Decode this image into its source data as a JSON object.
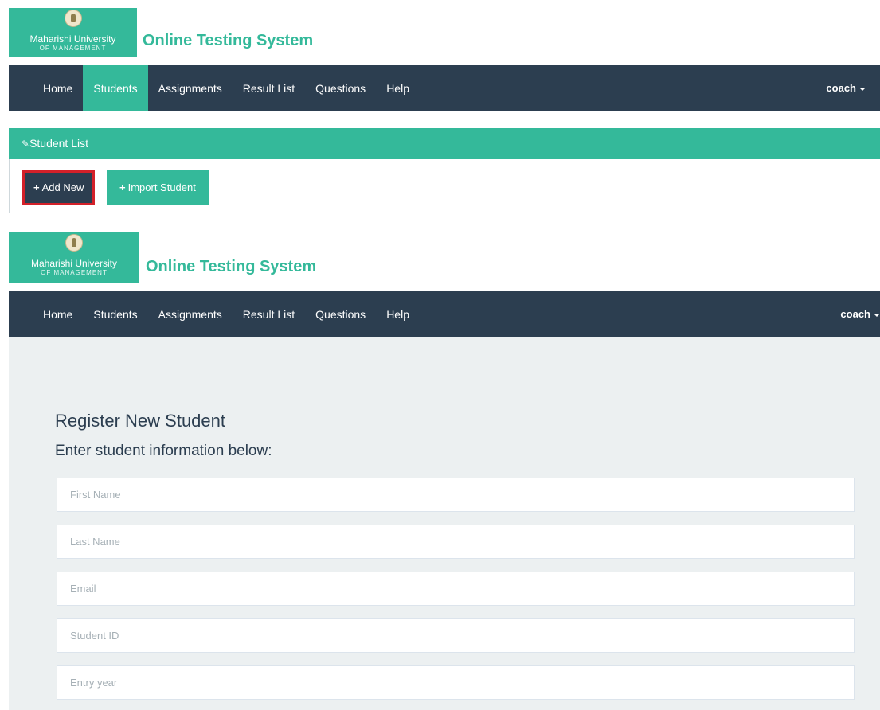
{
  "branding": {
    "university_line1": "Maharishi University",
    "university_line2": "OF MANAGEMENT",
    "app_title": "Online Testing System"
  },
  "nav": {
    "items": [
      "Home",
      "Students",
      "Assignments",
      "Result List",
      "Questions",
      "Help"
    ],
    "active_item": "Students",
    "user_label": "coach"
  },
  "student_list_panel": {
    "heading": "Student List",
    "add_button_label": "Add New",
    "import_button_label": "Import Student"
  },
  "register_form": {
    "heading": "Register New Student",
    "subheading": "Enter student information below:",
    "fields": [
      {
        "placeholder": "First Name",
        "value": ""
      },
      {
        "placeholder": "Last Name",
        "value": ""
      },
      {
        "placeholder": "Email",
        "value": ""
      },
      {
        "placeholder": "Student ID",
        "value": ""
      },
      {
        "placeholder": "Entry year",
        "value": ""
      }
    ]
  },
  "colors": {
    "accent": "#34b99a",
    "navbar": "#2c3e50",
    "highlight_border": "#d32029",
    "form_background": "#ecf0f1"
  }
}
